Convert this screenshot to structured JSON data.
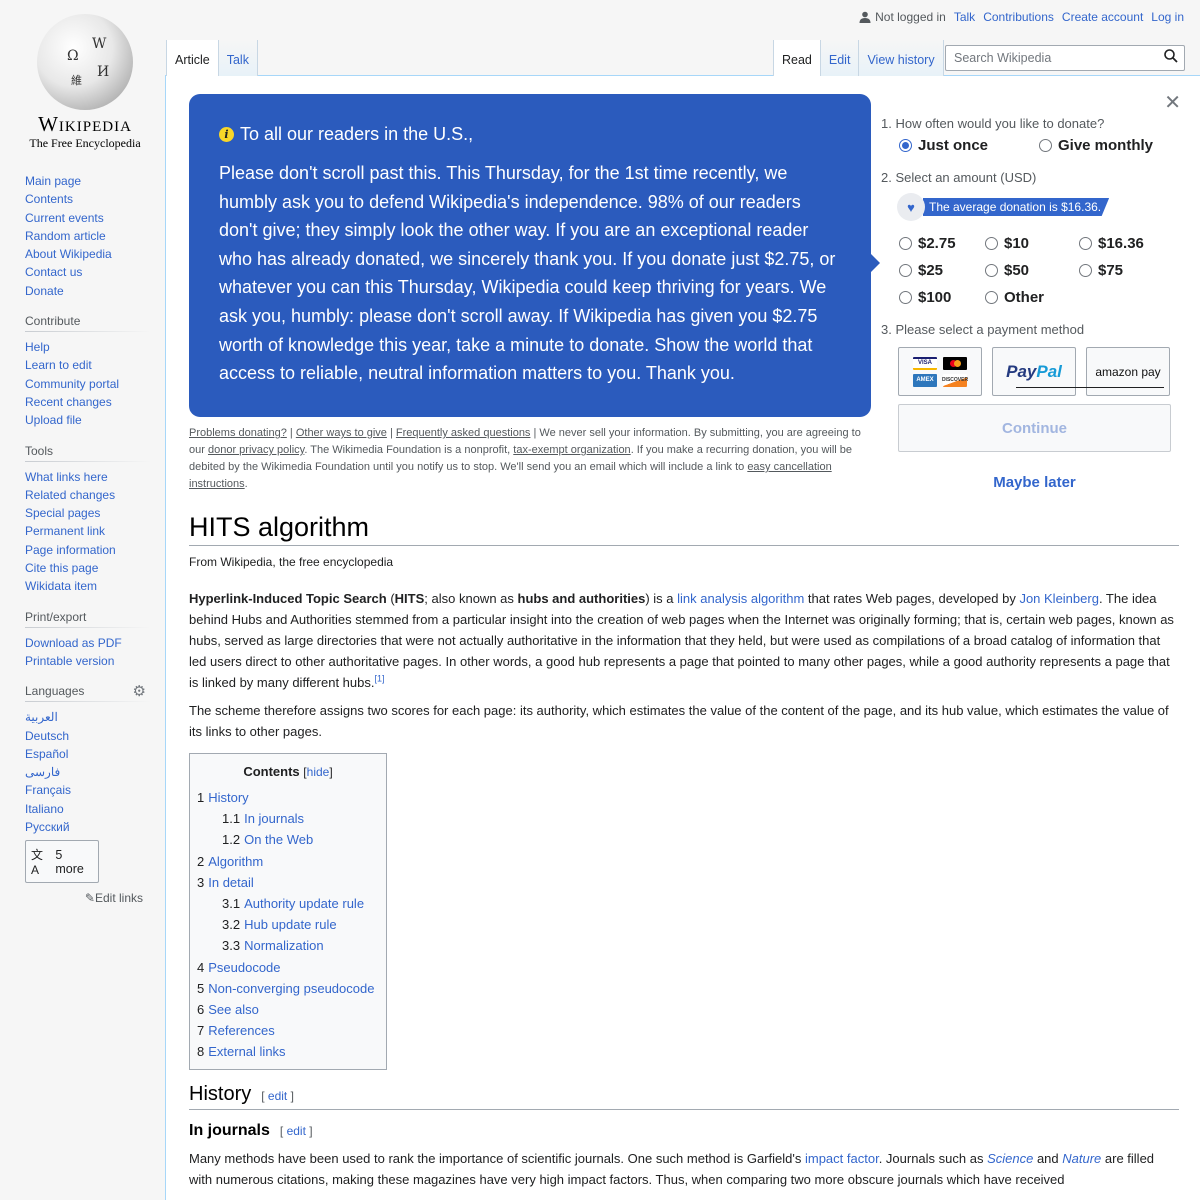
{
  "logo": {
    "wordmark": "Wikipedia",
    "tagline": "The Free Encyclopedia"
  },
  "personal": {
    "status": "Not logged in",
    "links": [
      "Talk",
      "Contributions",
      "Create account",
      "Log in"
    ]
  },
  "tabs": {
    "left": [
      "Article",
      "Talk"
    ],
    "right": [
      "Read",
      "Edit",
      "View history"
    ]
  },
  "search": {
    "placeholder": "Search Wikipedia"
  },
  "sidebar": {
    "navigation": [
      "Main page",
      "Contents",
      "Current events",
      "Random article",
      "About Wikipedia",
      "Contact us",
      "Donate"
    ],
    "contribute": {
      "heading": "Contribute",
      "items": [
        "Help",
        "Learn to edit",
        "Community portal",
        "Recent changes",
        "Upload file"
      ]
    },
    "tools": {
      "heading": "Tools",
      "items": [
        "What links here",
        "Related changes",
        "Special pages",
        "Permanent link",
        "Page information",
        "Cite this page",
        "Wikidata item"
      ]
    },
    "print": {
      "heading": "Print/export",
      "items": [
        "Download as PDF",
        "Printable version"
      ]
    },
    "languages": {
      "heading": "Languages",
      "items": [
        "العربية",
        "Deutsch",
        "Español",
        "فارسی",
        "Français",
        "Italiano",
        "Русский"
      ],
      "more": "5 more",
      "edit_links": "Edit links"
    }
  },
  "banner": {
    "heading": "To all our readers in the U.S.,",
    "body": "Please don't scroll past this. This Thursday, for the 1st time recently, we humbly ask you to defend Wikipedia's independence. 98% of our readers don't give; they simply look the other way. If you are an exceptional reader who has already donated, we sincerely thank you. If you donate just $2.75, or whatever you can this Thursday, Wikipedia could keep thriving for years. We ask you, humbly: please don't scroll away. If Wikipedia has given you $2.75 worth of knowledge this year, take a minute to donate. Show the world that access to reliable, neutral information matters to you. Thank you.",
    "color": "#2b5bbd"
  },
  "disclaimer": {
    "link1": "Problems donating?",
    "link2": "Other ways to give",
    "link3": "Frequently asked questions",
    "text1": " | We never sell your information. By submitting, you are agreeing to our ",
    "link4": "donor privacy policy",
    "text2": ". The Wikimedia Foundation is a nonprofit, ",
    "link5": "tax-exempt organization",
    "text3": ". If you make a recurring donation, you will be debited by the Wikimedia Foundation until you notify us to stop. We'll send you an email which will include a link to ",
    "link6": "easy cancellation instructions",
    "text4": "."
  },
  "donate_form": {
    "q1": "1. How often would you like to donate?",
    "frequency": [
      {
        "label": "Just once",
        "selected": true
      },
      {
        "label": "Give monthly",
        "selected": false
      }
    ],
    "q2": "2. Select an amount (USD)",
    "average": "The average donation is $16.36.",
    "amounts": [
      "$2.75",
      "$10",
      "$16.36",
      "$25",
      "$50",
      "$75",
      "$100",
      "Other"
    ],
    "q3": "3. Please select a payment method",
    "payment_methods": {
      "cards": [
        "VISA",
        "Mastercard",
        "AMEX",
        "DISCOVER"
      ],
      "paypal_a": "Pay",
      "paypal_b": "Pal",
      "amazon": "amazon pay"
    },
    "continue": "Continue",
    "maybe_later": "Maybe later"
  },
  "article": {
    "title": "HITS algorithm",
    "site_sub": "From Wikipedia, the free encyclopedia",
    "p1": {
      "b1": "Hyperlink-Induced Topic Search",
      "t1": " (",
      "b2": "HITS",
      "t2": "; also known as ",
      "b3": "hubs and authorities",
      "t3": ") is a ",
      "l1": "link analysis algorithm",
      "t4": " that rates Web pages, developed by ",
      "l2": "Jon Kleinberg",
      "t5": ". The idea behind Hubs and Authorities stemmed from a particular insight into the creation of web pages when the Internet was originally forming; that is, certain web pages, known as hubs, served as large directories that were not actually authoritative in the information that they held, but were used as compilations of a broad catalog of information that led users direct to other authoritative pages. In other words, a good hub represents a page that pointed to many other pages, while a good authority represents a page that is linked by many different hubs.",
      "ref": "[1]"
    },
    "p2": "The scheme therefore assigns two scores for each page: its authority, which estimates the value of the content of the page, and its hub value, which estimates the value of its links to other pages.",
    "toc": {
      "title": "Contents",
      "toggle": "hide",
      "items": [
        {
          "num": "1",
          "label": "History",
          "level": 1
        },
        {
          "num": "1.1",
          "label": "In journals",
          "level": 2
        },
        {
          "num": "1.2",
          "label": "On the Web",
          "level": 2
        },
        {
          "num": "2",
          "label": "Algorithm",
          "level": 1
        },
        {
          "num": "3",
          "label": "In detail",
          "level": 1
        },
        {
          "num": "3.1",
          "label": "Authority update rule",
          "level": 2
        },
        {
          "num": "3.2",
          "label": "Hub update rule",
          "level": 2
        },
        {
          "num": "3.3",
          "label": "Normalization",
          "level": 2
        },
        {
          "num": "4",
          "label": "Pseudocode",
          "level": 1
        },
        {
          "num": "5",
          "label": "Non-converging pseudocode",
          "level": 1
        },
        {
          "num": "6",
          "label": "See also",
          "level": 1
        },
        {
          "num": "7",
          "label": "References",
          "level": 1
        },
        {
          "num": "8",
          "label": "External links",
          "level": 1
        }
      ]
    },
    "history": {
      "heading": "History",
      "edit": "edit"
    },
    "in_journals": {
      "heading": "In journals",
      "edit": "edit"
    },
    "p3": {
      "t1": "Many methods have been used to rank the importance of scientific journals. One such method is Garfield's ",
      "l1": "impact factor",
      "t2": ". Journals such as ",
      "l2": "Science",
      "t3": " and ",
      "l3": "Nature",
      "t4": " are filled with numerous citations, making these magazines have very high impact factors. Thus, when comparing two more obscure journals which have received"
    }
  }
}
